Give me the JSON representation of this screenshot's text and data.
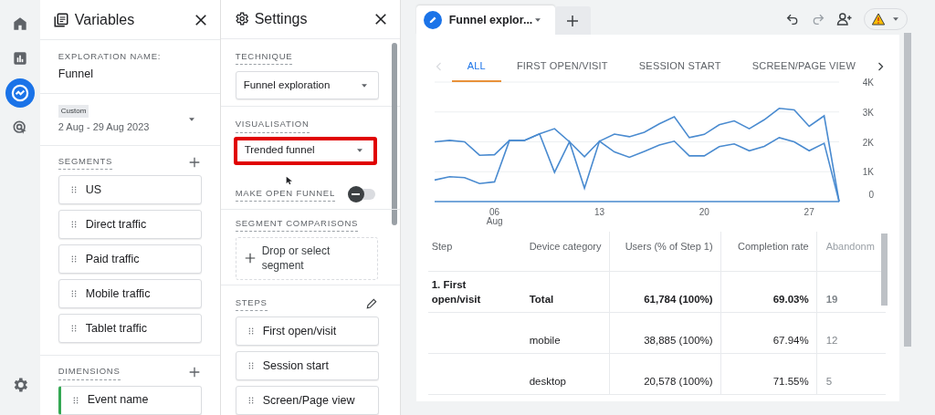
{
  "nav": [
    {
      "kind": "home",
      "selected": false
    },
    {
      "kind": "reports",
      "selected": false
    },
    {
      "kind": "explore",
      "selected": true
    },
    {
      "kind": "advertising",
      "selected": false
    }
  ],
  "variables": {
    "title": "Variables",
    "exploration_name_label": "EXPLORATION NAME:",
    "exploration_name": "Funnel",
    "date_range": {
      "badge": "Custom",
      "value": "2 Aug - 29 Aug 2023"
    },
    "segments": {
      "label": "SEGMENTS",
      "items": [
        "US",
        "Direct traffic",
        "Paid traffic",
        "Mobile traffic",
        "Tablet traffic"
      ]
    },
    "dimensions": {
      "label": "DIMENSIONS",
      "items": [
        "Event name"
      ]
    }
  },
  "settings": {
    "title": "Settings",
    "technique": {
      "label": "TECHNIQUE",
      "value": "Funnel exploration"
    },
    "visualisation": {
      "label": "VISUALISATION",
      "value": "Trended funnel",
      "highlighted": true
    },
    "open_funnel": {
      "label": "MAKE OPEN FUNNEL",
      "on": false
    },
    "segment_comparisons": {
      "label": "SEGMENT COMPARISONS",
      "placeholder": "Drop or select segment"
    },
    "steps": {
      "label": "STEPS",
      "items": [
        "First open/visit",
        "Session start",
        "Screen/Page view"
      ]
    }
  },
  "tab": {
    "title": "Funnel explor..."
  },
  "chart_tabs": [
    {
      "label": "ALL",
      "selected": true
    },
    {
      "label": "FIRST OPEN/VISIT",
      "selected": false
    },
    {
      "label": "SESSION START",
      "selected": false
    },
    {
      "label": "SCREEN/PAGE VIEW",
      "selected": false
    }
  ],
  "chart_data": {
    "type": "line",
    "x": [
      2,
      3,
      4,
      5,
      6,
      7,
      8,
      9,
      10,
      11,
      12,
      13,
      14,
      15,
      16,
      17,
      18,
      19,
      20,
      21,
      22,
      23,
      24,
      25,
      26,
      27,
      28,
      29
    ],
    "series": [
      {
        "color": "#4a8bd0",
        "values": [
          2000,
          2050,
          2000,
          1550,
          1570,
          2050,
          2050,
          2270,
          2440,
          2000,
          1500,
          2020,
          2260,
          2170,
          2320,
          2600,
          2840,
          2140,
          2250,
          2570,
          2700,
          2440,
          2740,
          3120,
          3070,
          2520,
          2870,
          0
        ]
      },
      {
        "color": "#4a8bd0",
        "values": [
          720,
          830,
          800,
          600,
          660,
          2050,
          2050,
          2270,
          980,
          2000,
          450,
          2020,
          1660,
          1480,
          1680,
          1890,
          2020,
          1530,
          1530,
          1840,
          1930,
          1700,
          1850,
          2140,
          2000,
          1700,
          1950,
          0
        ]
      },
      {
        "color": "#4a8bd0",
        "values": [
          0,
          0,
          0,
          0,
          0,
          0,
          0,
          0,
          0,
          0,
          0,
          0,
          0,
          0,
          0,
          0,
          0,
          0,
          0,
          0,
          0,
          0,
          0,
          0,
          0,
          0,
          0,
          0
        ]
      }
    ],
    "xlim": [
      2,
      29
    ],
    "grid": true,
    "xticks": [
      {
        "value": 6,
        "label": "06 Aug"
      },
      13,
      20,
      27
    ],
    "yticks": [
      0,
      {
        "value": 1000,
        "label": "1K"
      },
      {
        "value": 2000,
        "label": "2K"
      },
      {
        "value": 3000,
        "label": "3K"
      },
      {
        "value": 4000,
        "label": "4K"
      }
    ],
    "ylim": [
      0,
      4000
    ]
  },
  "table": {
    "columns": [
      "Step",
      "Device category",
      "Users (% of Step 1)",
      "Completion rate",
      "Abandonm"
    ],
    "rows": [
      {
        "total": true,
        "cells": [
          "1. First open/visit",
          "Total",
          "61,784 (100%)",
          "69.03%",
          "19"
        ]
      },
      {
        "total": false,
        "cells": [
          "",
          "mobile",
          "38,885 (100%)",
          "67.94%",
          "12"
        ]
      },
      {
        "total": false,
        "cells": [
          "",
          "desktop",
          "20,578 (100%)",
          "71.55%",
          "5"
        ]
      }
    ]
  }
}
